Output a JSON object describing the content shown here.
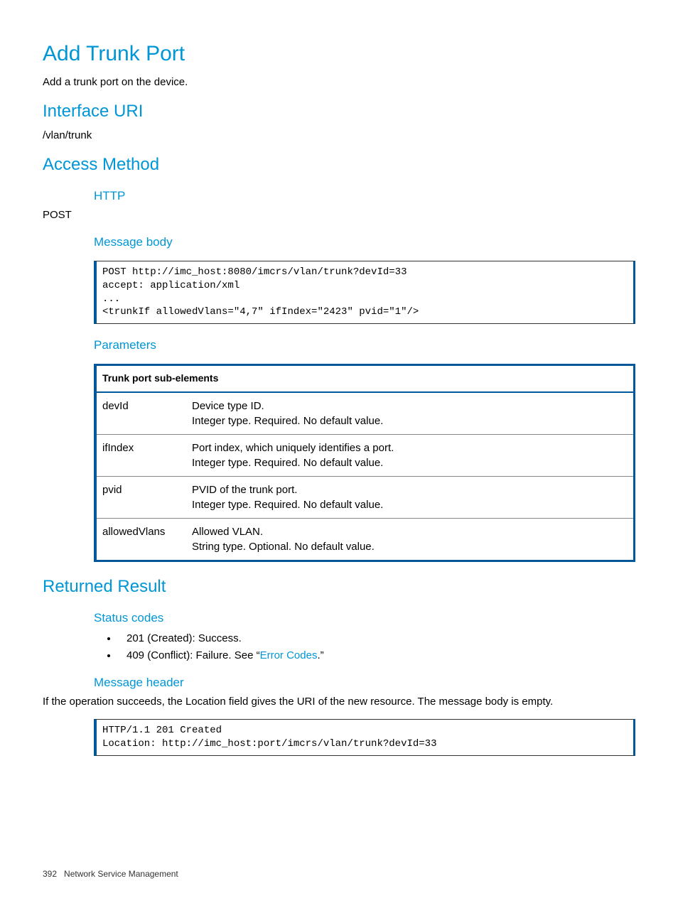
{
  "title": "Add Trunk Port",
  "desc": "Add a trunk port on the device.",
  "interface_uri": {
    "heading": "Interface URI",
    "value": "/vlan/trunk"
  },
  "access_method": {
    "heading": "Access Method",
    "http_heading": "HTTP",
    "http_verb": "POST",
    "msgbody_heading": "Message body",
    "msgbody_code": "POST http://imc_host:8080/imcrs/vlan/trunk?devId=33\naccept: application/xml\n...\n<trunkIf allowedVlans=\"4,7\" ifIndex=\"2423\" pvid=\"1\"/>",
    "params_heading": "Parameters",
    "params_table_header": "Trunk port sub-elements",
    "params": [
      {
        "name": "devId",
        "line1": "Device type ID.",
        "line2": "Integer type. Required. No default value."
      },
      {
        "name": "ifIndex",
        "line1": "Port index, which uniquely identifies a port.",
        "line2": "Integer type. Required. No default value."
      },
      {
        "name": "pvid",
        "line1": "PVID of the trunk port.",
        "line2": "Integer type. Required. No default value."
      },
      {
        "name": "allowedVlans",
        "line1": "Allowed VLAN.",
        "line2": "String type. Optional. No default value."
      }
    ]
  },
  "returned": {
    "heading": "Returned Result",
    "status_heading": "Status codes",
    "status_items": [
      {
        "text": "201 (Created): Success."
      },
      {
        "pre": "409 (Conflict): Failure. See “",
        "link": "Error Codes",
        "post": ".”"
      }
    ],
    "msghdr_heading": "Message header",
    "msghdr_text": "If the operation succeeds, the Location field gives the URI of the new resource. The message body is empty.",
    "msghdr_code": "HTTP/1.1 201 Created\nLocation: http://imc_host:port/imcrs/vlan/trunk?devId=33"
  },
  "footer": {
    "page": "392",
    "section": "Network Service Management"
  }
}
